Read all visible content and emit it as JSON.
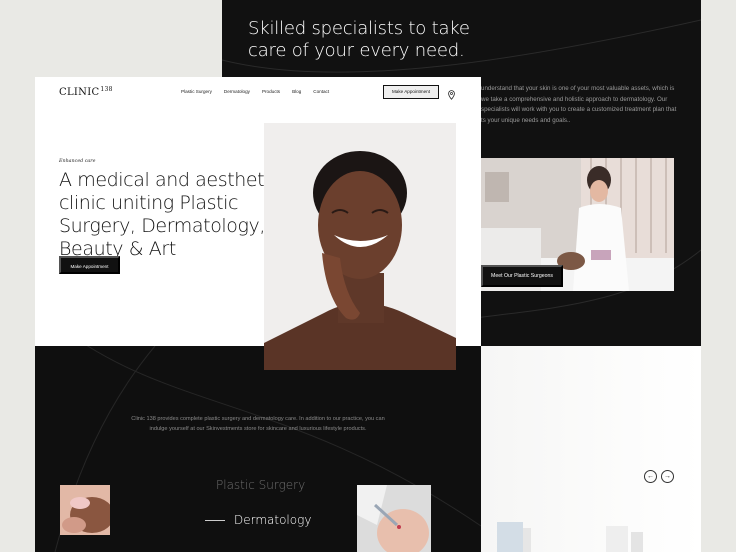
{
  "back_panel": {
    "heading": "Skilled specialists to take care of your every need.",
    "paragraph": "understand that your skin is one of your most valuable assets, which is we take a comprehensive and holistic approach to dermatology. Our specialists will work with you to create a customized treatment plan that ts your unique needs and goals..",
    "surgeons_button": "Meet Our Plastic Surgeons"
  },
  "header": {
    "logo_text": "CLINIC",
    "logo_number": "138",
    "nav": [
      "Plastic Surgery",
      "Dermatology",
      "Products",
      "Blog",
      "Contact"
    ],
    "appointment_button": "Make Appointment",
    "location_icon": "map-pin-icon"
  },
  "hero": {
    "eyebrow": "Enhanced care",
    "title": "A medical and aesthetic clinic uniting Plastic Surgery, Dermatology, Beauty & Art",
    "cta": "Make Appointment"
  },
  "about": {
    "intro": "Clinic 138 provides complete plastic surgery and dermatology care. In addition to our practice, you can indulge yourself at our Skinvestments store for skincare and luxurious lifestyle products."
  },
  "services": {
    "items": [
      "Plastic Surgery",
      "Dermatology"
    ]
  },
  "carousel": {
    "prev_icon": "arrow-left-icon",
    "next_icon": "arrow-right-icon"
  },
  "colors": {
    "dark": "#111111",
    "light_bg": "#e9e9e5",
    "white": "#ffffff"
  }
}
